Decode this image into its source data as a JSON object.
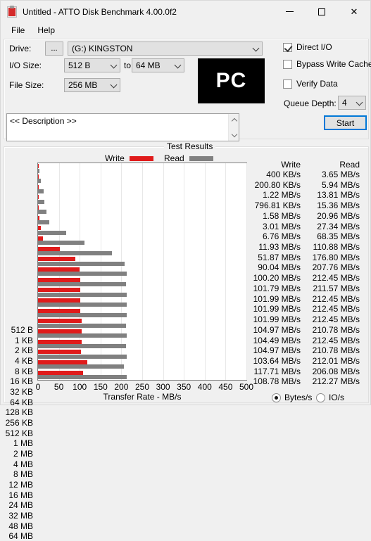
{
  "window": {
    "title": "Untitled - ATTO Disk Benchmark 4.00.0f2",
    "icon": "clipboard-icon",
    "minimize": "—",
    "maximize": "",
    "close": "✕"
  },
  "menu": {
    "items": [
      "File",
      "Help"
    ]
  },
  "settings": {
    "drive_label": "Drive:",
    "browse_button": "...",
    "drive_value": "(G:) KINGSTON",
    "io_size_label": "I/O Size:",
    "io_size_from": "512 B",
    "io_to_label": "to",
    "io_size_to": "64 MB",
    "file_size_label": "File Size:",
    "file_size_value": "256 MB",
    "logo_text": "PC",
    "direct_io_label": "Direct I/O",
    "direct_io_checked": true,
    "bypass_write_cache_label": "Bypass Write Cache",
    "bypass_write_cache_checked": false,
    "verify_data_label": "Verify Data",
    "verify_data_checked": false,
    "queue_depth_label": "Queue Depth:",
    "queue_depth_value": "4",
    "start_button": "Start"
  },
  "description": {
    "value": "<< Description >>",
    "scroll_up_icon": "chevron-up-icon",
    "scroll_down_icon": "chevron-down-icon"
  },
  "results": {
    "group_title": "Test Results",
    "legend": [
      {
        "label": "Write",
        "color": "#e01b1b"
      },
      {
        "label": "Read",
        "color": "#808080"
      }
    ],
    "column_headers": [
      "Write",
      "Read"
    ],
    "units": {
      "bytes_label": "Bytes/s",
      "bytes_selected": true,
      "io_label": "IO/s",
      "io_selected": false
    }
  },
  "chart_data": {
    "type": "bar",
    "title": "Test Results",
    "orientation": "horizontal",
    "xlabel": "Transfer Rate - MB/s",
    "ylabel": "",
    "xlim": [
      0,
      500
    ],
    "xticks": [
      0,
      50,
      100,
      150,
      200,
      250,
      300,
      350,
      400,
      450,
      500
    ],
    "grid": true,
    "legend_position": "top",
    "categories": [
      "512 B",
      "1 KB",
      "2 KB",
      "4 KB",
      "8 KB",
      "16 KB",
      "32 KB",
      "64 KB",
      "128 KB",
      "256 KB",
      "512 KB",
      "1 MB",
      "2 MB",
      "4 MB",
      "8 MB",
      "12 MB",
      "16 MB",
      "24 MB",
      "32 MB",
      "48 MB",
      "64 MB"
    ],
    "series": [
      {
        "name": "Write",
        "color": "#e01b1b",
        "values": [
          0.4,
          0.2008,
          1.22,
          0.79681,
          1.58,
          3.01,
          6.76,
          11.93,
          51.87,
          90.04,
          100.2,
          101.79,
          101.99,
          101.99,
          101.99,
          104.97,
          104.49,
          104.97,
          103.64,
          117.71,
          108.78
        ],
        "labels": [
          "400 KB/s",
          "200.80 KB/s",
          "1.22 MB/s",
          "796.81 KB/s",
          "1.58 MB/s",
          "3.01 MB/s",
          "6.76 MB/s",
          "11.93 MB/s",
          "51.87 MB/s",
          "90.04 MB/s",
          "100.20 MB/s",
          "101.79 MB/s",
          "101.99 MB/s",
          "101.99 MB/s",
          "101.99 MB/s",
          "104.97 MB/s",
          "104.49 MB/s",
          "104.97 MB/s",
          "103.64 MB/s",
          "117.71 MB/s",
          "108.78 MB/s"
        ]
      },
      {
        "name": "Read",
        "color": "#808080",
        "values": [
          3.65,
          5.94,
          13.81,
          15.36,
          20.96,
          27.34,
          68.35,
          110.88,
          176.8,
          207.76,
          212.45,
          211.57,
          212.45,
          212.45,
          212.45,
          210.78,
          212.45,
          210.78,
          212.01,
          206.08,
          212.27
        ],
        "labels": [
          "3.65 MB/s",
          "5.94 MB/s",
          "13.81 MB/s",
          "15.36 MB/s",
          "20.96 MB/s",
          "27.34 MB/s",
          "68.35 MB/s",
          "110.88 MB/s",
          "176.80 MB/s",
          "207.76 MB/s",
          "212.45 MB/s",
          "211.57 MB/s",
          "212.45 MB/s",
          "212.45 MB/s",
          "212.45 MB/s",
          "210.78 MB/s",
          "212.45 MB/s",
          "210.78 MB/s",
          "212.01 MB/s",
          "206.08 MB/s",
          "212.27 MB/s"
        ]
      }
    ]
  }
}
